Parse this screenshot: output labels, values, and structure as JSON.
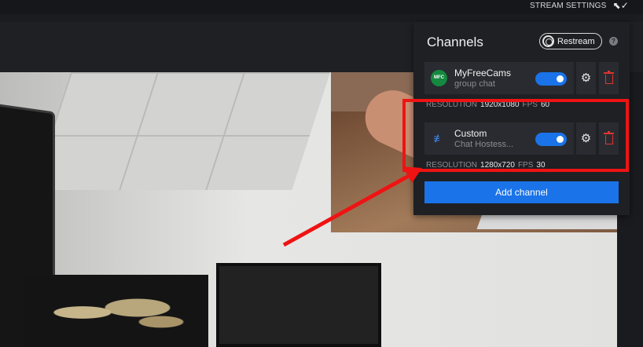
{
  "topbar": {
    "stream_settings_label": "STREAM SETTINGS",
    "icon": "cursor-check-icon"
  },
  "panel": {
    "title": "Channels",
    "restream_label": "Restream",
    "help_label": "?",
    "channels": [
      {
        "logo_text": "MFC",
        "name": "MyFreeCams",
        "subtitle": "group chat",
        "enabled": true,
        "resolution_label": "RESOLUTION",
        "resolution": "1920x1080",
        "fps_label": "FPS",
        "fps": "60"
      },
      {
        "logo_text": "≢",
        "name": "Custom",
        "subtitle": "Chat Hostess...",
        "enabled": true,
        "resolution_label": "RESOLUTION",
        "resolution": "1280x720",
        "fps_label": "FPS",
        "fps": "30"
      }
    ],
    "add_channel_label": "Add channel"
  },
  "annotation": {
    "color": "#ef1313"
  },
  "colors": {
    "accent": "#1a73e8",
    "danger": "#e0342f",
    "brand_mfc": "#15893f"
  }
}
